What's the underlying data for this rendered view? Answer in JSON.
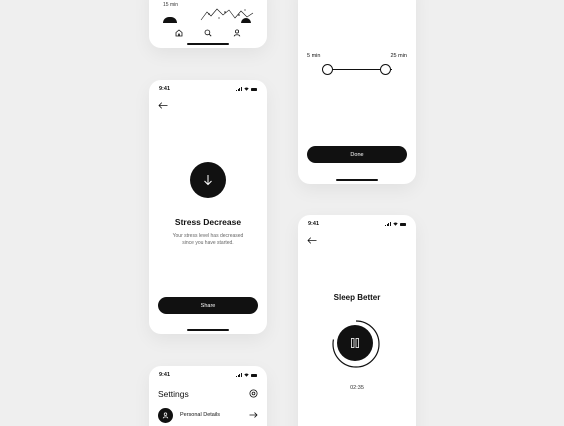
{
  "meditation_card": {
    "session_time": "15 min",
    "tabs": [
      {
        "icon": "home-icon"
      },
      {
        "icon": "search-icon"
      },
      {
        "icon": "profile-icon"
      }
    ]
  },
  "duration_screen": {
    "min_label": "5 min",
    "max_label": "25 min",
    "slider_range_fraction": [
      0.0,
      1.0
    ],
    "done_label": "Done"
  },
  "result_screen": {
    "status_time": "9:41",
    "title": "Stress Decrease",
    "description": "Your stress level has decreased since you have started.",
    "share_label": "Share",
    "icon": "arrow-down-icon"
  },
  "settings_screen": {
    "status_time": "9:41",
    "title": "Settings",
    "items": [
      {
        "label": "Personal Details",
        "icon": "user-icon"
      }
    ]
  },
  "sleep_screen": {
    "status_time": "9:41",
    "title": "Sleep Better",
    "timer": "02:35",
    "progress": 0.78,
    "icon": "pause-icon"
  },
  "colors": {
    "background": "#efefef",
    "card": "#ffffff",
    "accent": "#111111",
    "muted_text": "#666666"
  }
}
